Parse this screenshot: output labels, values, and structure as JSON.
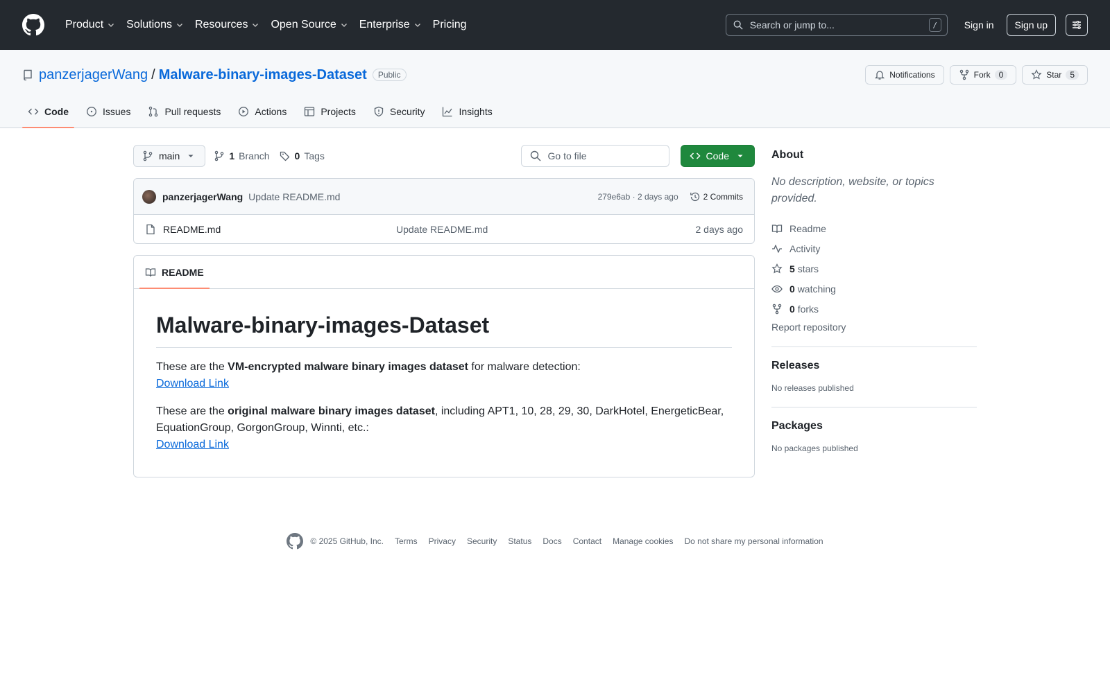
{
  "header": {
    "nav": [
      "Product",
      "Solutions",
      "Resources",
      "Open Source",
      "Enterprise",
      "Pricing"
    ],
    "search_placeholder": "Search or jump to...",
    "search_shortcut": "/",
    "sign_in": "Sign in",
    "sign_up": "Sign up"
  },
  "repo": {
    "owner": "panzerjagerWang",
    "separator": "/",
    "name": "Malware-binary-images-Dataset",
    "visibility": "Public",
    "notifications_label": "Notifications",
    "fork_label": "Fork",
    "fork_count": "0",
    "star_label": "Star",
    "star_count": "5",
    "tabs": [
      "Code",
      "Issues",
      "Pull requests",
      "Actions",
      "Projects",
      "Security",
      "Insights"
    ]
  },
  "file_nav": {
    "branch": "main",
    "branch_count": "1",
    "branch_label": "Branch",
    "tag_count": "0",
    "tag_label": "Tags",
    "goto_placeholder": "Go to file",
    "code_button": "Code"
  },
  "commit": {
    "author": "panzerjagerWang",
    "message": "Update README.md",
    "meta": "279e6ab · 2 days ago",
    "commits_label": "2 Commits"
  },
  "files": [
    {
      "name": "README.md",
      "message": "Update README.md",
      "time": "2 days ago"
    }
  ],
  "readme": {
    "tab_label": "README",
    "title": "Malware-binary-images-Dataset",
    "p1_before": "These are the ",
    "p1_bold": "VM-encrypted malware binary images dataset",
    "p1_after": " for malware detection:",
    "p1_link": "Download Link",
    "p2_before": "These are the ",
    "p2_bold": "original malware binary images dataset",
    "p2_after": ", including APT1, 10, 28, 29, 30, DarkHotel, EnergeticBear, EquationGroup, GorgonGroup, Winnti, etc.:",
    "p2_link": "Download Link"
  },
  "sidebar": {
    "about_title": "About",
    "about_desc": "No description, website, or topics provided.",
    "readme_label": "Readme",
    "activity_label": "Activity",
    "stars_count": "5",
    "stars_label": "stars",
    "watching_count": "0",
    "watching_label": "watching",
    "forks_count": "0",
    "forks_label": "forks",
    "report_label": "Report repository",
    "releases_title": "Releases",
    "releases_text": "No releases published",
    "packages_title": "Packages",
    "packages_text": "No packages published"
  },
  "footer": {
    "copyright": "© 2025 GitHub, Inc.",
    "links": [
      "Terms",
      "Privacy",
      "Security",
      "Status",
      "Docs",
      "Contact",
      "Manage cookies",
      "Do not share my personal information"
    ]
  },
  "colors": {
    "header_bg": "#24292f",
    "link": "#0969da",
    "code_button": "#1f883d",
    "active_tab_underline": "#fd8c73"
  }
}
